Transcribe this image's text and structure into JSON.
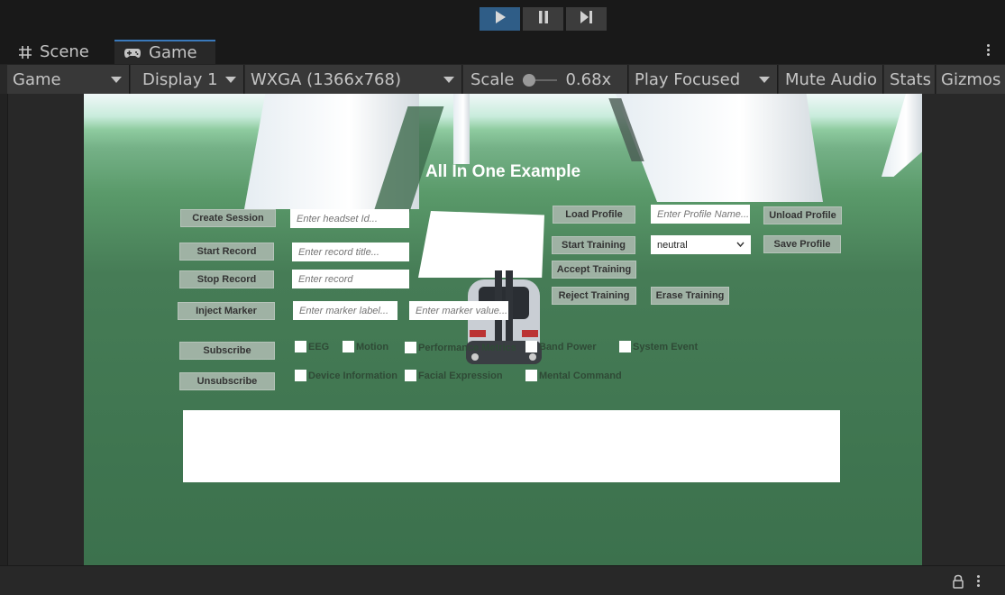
{
  "toolbar": {
    "play": "play-icon",
    "pause": "pause-icon",
    "step": "step-icon"
  },
  "tabs": [
    {
      "label": "Scene",
      "icon": "grid-icon"
    },
    {
      "label": "Game",
      "icon": "gamepad-icon"
    }
  ],
  "game_toolbar": {
    "view_select": "Game",
    "display_select": "Display 1",
    "resolution_select": "WXGA (1366x768)",
    "scale_label": "Scale",
    "scale_value": "0.68x",
    "play_mode_select": "Play Focused",
    "mute_audio": "Mute Audio",
    "stats": "Stats",
    "gizmos": "Gizmos"
  },
  "game": {
    "title": "All In One Example",
    "buttons": {
      "create_session": "Create Session",
      "start_record": "Start Record",
      "stop_record": "Stop Record",
      "inject_marker": "Inject Marker",
      "subscribe": "Subscribe",
      "unsubscribe": "Unsubscribe",
      "load_profile": "Load Profile",
      "unload_profile": "Unload Profile",
      "start_training": "Start Training",
      "save_profile": "Save Profile",
      "accept_training": "Accept Training",
      "reject_training": "Reject Training",
      "erase_training": "Erase Training"
    },
    "inputs": {
      "headset_id": "Enter headset Id...",
      "record_title": "Enter record title...",
      "record_description": "Enter record",
      "marker_label": "Enter marker label...",
      "marker_value": "Enter marker value...",
      "profile_name": "Enter Profile Name..."
    },
    "training_select": "neutral",
    "checkboxes": {
      "eeg": "EEG",
      "motion": "Motion",
      "performance_metrics": "Performance Metrics",
      "band_power": "Band Power",
      "system_event": "System Event",
      "device_information": "Device Information",
      "facial_expression": "Facial Expression",
      "mental_command": "Mental Command"
    }
  },
  "statusbar": {
    "lock": "lock-icon",
    "menu": "kebab-menu-icon"
  },
  "colors": {
    "accent": "#2f5d87",
    "tab_highlight": "#3a79bb",
    "ground": "#3f7550",
    "ui_button": "#9fb2a4"
  }
}
